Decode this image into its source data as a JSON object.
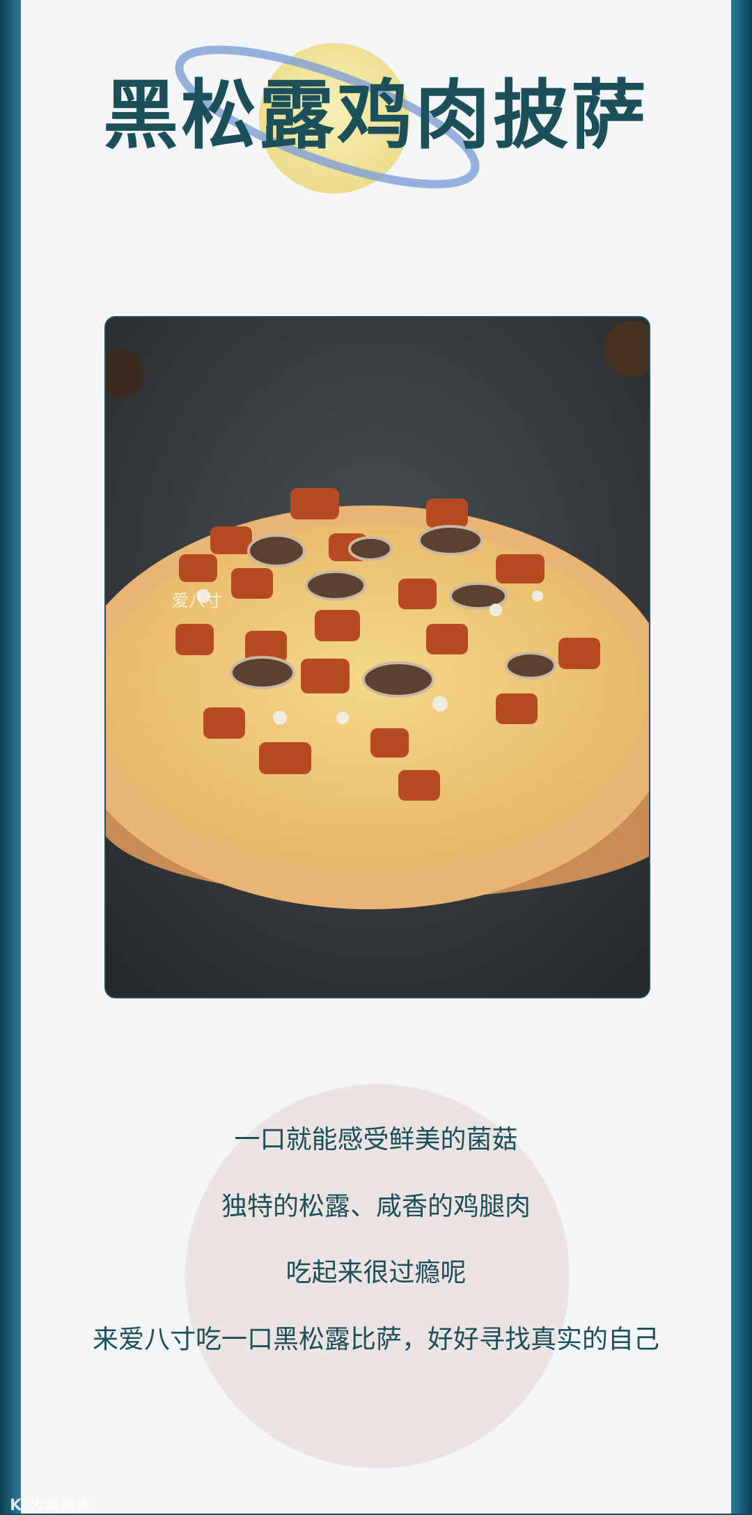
{
  "header": {
    "title": "黑松露鸡肉披萨"
  },
  "photo": {
    "watermark_text": "爱八寸"
  },
  "description": {
    "lines": [
      "一口就能感受鲜美的菌菇",
      "独特的松露、咸香的鸡腿肉",
      "吃起来很过瘾呢",
      "来爱八寸吃一口黑松露比萨，好好寻找真实的自己"
    ]
  },
  "footer": {
    "watermark_label": "大敢路境",
    "watermark_glyph": "K"
  },
  "colors": {
    "frame": "#0f4c63",
    "title": "#1b4f5a",
    "background": "#f3f5f6",
    "circle": "#ece4e3",
    "moon": "#f2e6a1",
    "ring": "#7e9fd6"
  }
}
